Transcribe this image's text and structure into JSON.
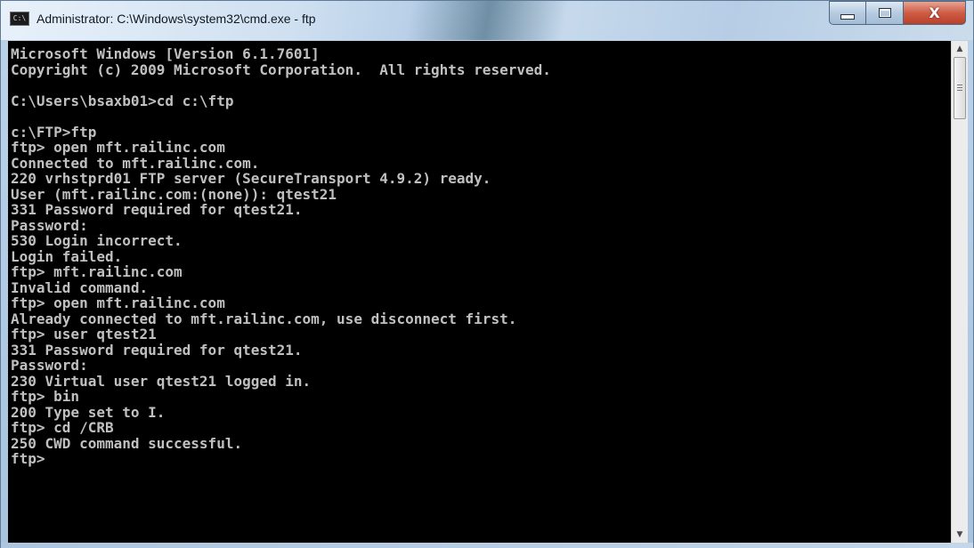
{
  "window": {
    "title": "Administrator: C:\\Windows\\system32\\cmd.exe - ftp",
    "icon_label": "C:\\",
    "controls": {
      "minimize_icon": "minimize-icon",
      "maximize_icon": "maximize-icon",
      "close_icon": "close-icon",
      "close_glyph": "X"
    }
  },
  "console": {
    "lines": [
      "Microsoft Windows [Version 6.1.7601]",
      "Copyright (c) 2009 Microsoft Corporation.  All rights reserved.",
      "",
      "C:\\Users\\bsaxb01>cd c:\\ftp",
      "",
      "c:\\FTP>ftp",
      "ftp> open mft.railinc.com",
      "Connected to mft.railinc.com.",
      "220 vrhstprd01 FTP server (SecureTransport 4.9.2) ready.",
      "User (mft.railinc.com:(none)): qtest21",
      "331 Password required for qtest21.",
      "Password:",
      "530 Login incorrect.",
      "Login failed.",
      "ftp> mft.railinc.com",
      "Invalid command.",
      "ftp> open mft.railinc.com",
      "Already connected to mft.railinc.com, use disconnect first.",
      "ftp> user qtest21",
      "331 Password required for qtest21.",
      "Password:",
      "230 Virtual user qtest21 logged in.",
      "ftp> bin",
      "200 Type set to I.",
      "ftp> cd /CRB",
      "250 CWD command successful.",
      "ftp>"
    ]
  },
  "scrollbar": {
    "up_arrow": "▲",
    "down_arrow": "▼"
  }
}
